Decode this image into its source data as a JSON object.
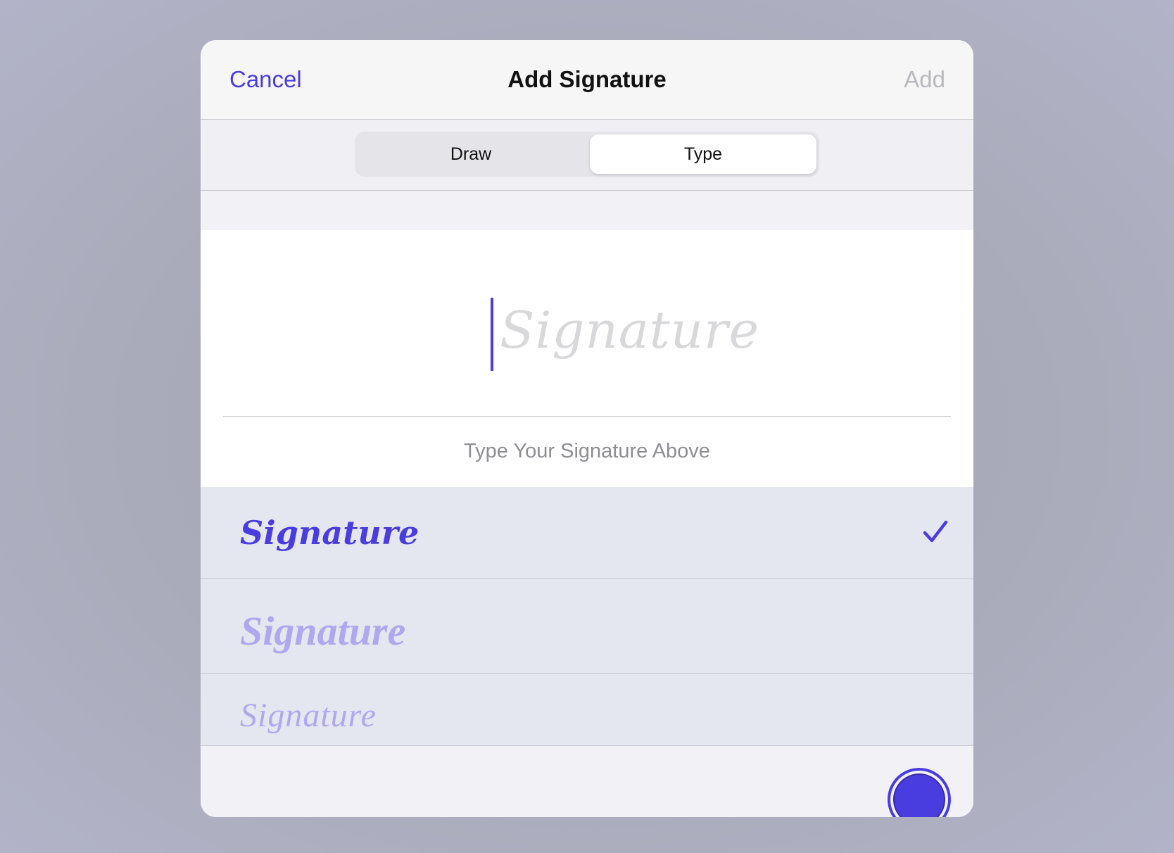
{
  "header": {
    "cancel_label": "Cancel",
    "title": "Add Signature",
    "add_label": "Add"
  },
  "segmented_control": {
    "options": [
      {
        "label": "Draw",
        "selected": false
      },
      {
        "label": "Type",
        "selected": true
      }
    ]
  },
  "signature_input": {
    "placeholder": "Signature",
    "value": "",
    "hint": "Type Your Signature Above"
  },
  "signature_styles": [
    {
      "label": "Signature",
      "selected": true
    },
    {
      "label": "Signature",
      "selected": false
    },
    {
      "label": "Signature",
      "selected": false
    }
  ],
  "colors": {
    "accent": "#4a3de0",
    "selected_ink": "#4a3de0",
    "unselected_ink": "#b0a8ee",
    "disabled": "#b8b8bd"
  },
  "icons": {
    "selected_style": "checkmark-icon",
    "ink_color": "color-swatch"
  }
}
